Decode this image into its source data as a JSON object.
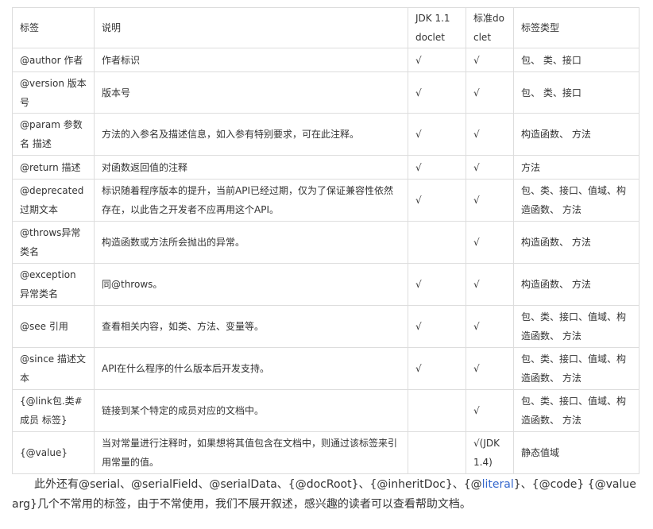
{
  "table": {
    "header": [
      "标签",
      "说明",
      "JDK 1.1 doclet",
      "标准doclet",
      "标签类型"
    ],
    "rows": [
      [
        "@author 作者",
        "作者标识",
        "√",
        "√",
        "包、 类、接口"
      ],
      [
        "@version 版本号",
        "版本号",
        "√",
        "√",
        "包、 类、接口"
      ],
      [
        "@param 参数名 描述",
        "方法的入参名及描述信息，如入参有特别要求，可在此注释。",
        "√",
        "√",
        "构造函数、 方法"
      ],
      [
        "@return 描述",
        "对函数返回值的注释",
        "√",
        "√",
        "方法"
      ],
      [
        "@deprecated 过期文本",
        "标识随着程序版本的提升，当前API已经过期，仅为了保证兼容性依然存在，以此告之开发者不应再用这个API。",
        "√",
        "√",
        "包、类、接口、值域、构造函数、 方法"
      ],
      [
        "@throws异常类名",
        "构造函数或方法所会抛出的异常。",
        "",
        "√",
        "构造函数、 方法"
      ],
      [
        "@exception 异常类名",
        "同@throws。",
        "√",
        "√",
        "构造函数、 方法"
      ],
      [
        "@see 引用",
        "查看相关内容，如类、方法、变量等。",
        "√",
        "√",
        "包、类、接口、值域、构造函数、 方法"
      ],
      [
        "@since 描述文本",
        "API在什么程序的什么版本后开发支持。",
        "√",
        "√",
        "包、类、接口、值域、构造函数、 方法"
      ],
      [
        "{@link包.类#成员 标签}",
        "链接到某个特定的成员对应的文档中。",
        "",
        "√",
        "包、类、接口、值域、构造函数、 方法"
      ],
      [
        "{@value}",
        "当对常量进行注释时，如果想将其值包含在文档中，则通过该标签来引用常量的值。",
        "",
        "√(JDK 1.4)",
        "静态值域"
      ]
    ]
  },
  "paragraph": {
    "before_link": "此外还有@serial、@serialField、@serialData、{@docRoot}、{@inheritDoc}、{@",
    "link_text": "literal",
    "after_link": "}、{@code} {@value arg}几个不常用的标签，由于不常使用，我们不展开叙述，感兴趣的读者可以查看帮助文档。"
  },
  "colors": {
    "text": "#333333",
    "border": "#dddddd",
    "link": "#3366cc"
  }
}
